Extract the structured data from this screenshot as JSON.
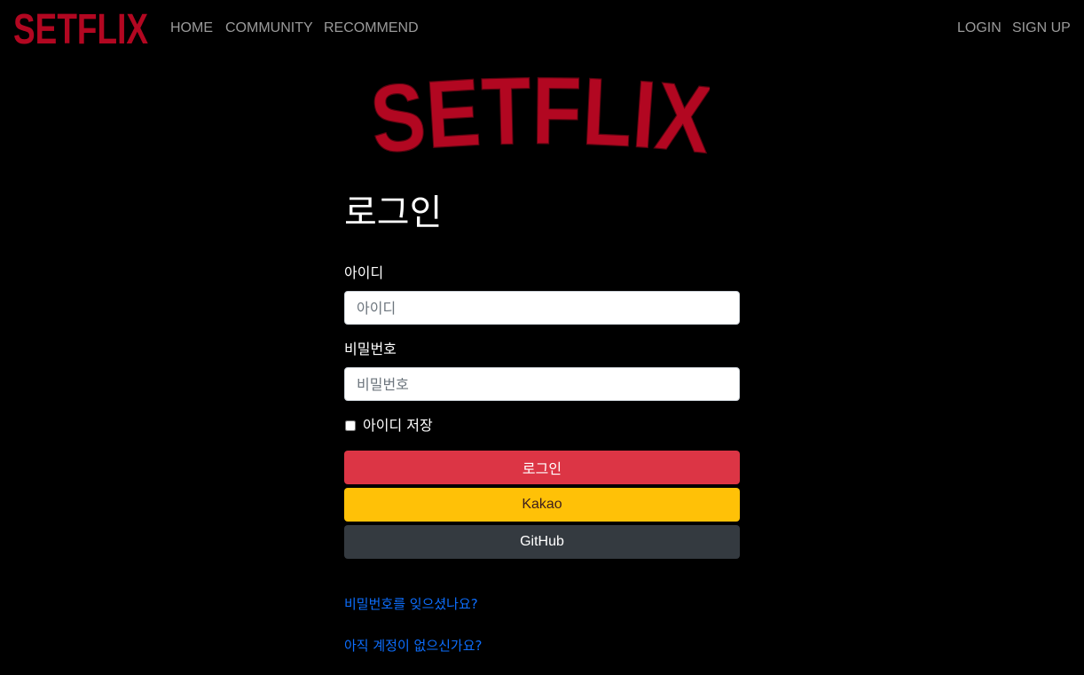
{
  "brand": {
    "name": "SETFLIX",
    "color": "#b20721"
  },
  "nav": {
    "home": "HOME",
    "community": "COMMUNITY",
    "recommend": "RECOMMEND",
    "login": "LOGIN",
    "signup": "SIGN UP",
    "color": "#9a9a9a"
  },
  "login_form": {
    "title": "로그인",
    "id_label": "아이디",
    "id_placeholder": "아이디",
    "id_value": "",
    "password_label": "비밀번호",
    "password_placeholder": "비밀번호",
    "password_value": "",
    "remember_label": "아이디 저장",
    "remember_checked": false,
    "submit_label": "로그인",
    "kakao_label": "Kakao",
    "github_label": "GitHub",
    "forgot_password_link": "비밀번호를 잊으셨나요?",
    "no_account_link": "아직 계정이 없으신가요?"
  },
  "colors": {
    "background": "#000000",
    "login_button": "#dc3545",
    "kakao_button": "#ffc107",
    "github_button": "#343a40",
    "link": "#0d6efd"
  }
}
